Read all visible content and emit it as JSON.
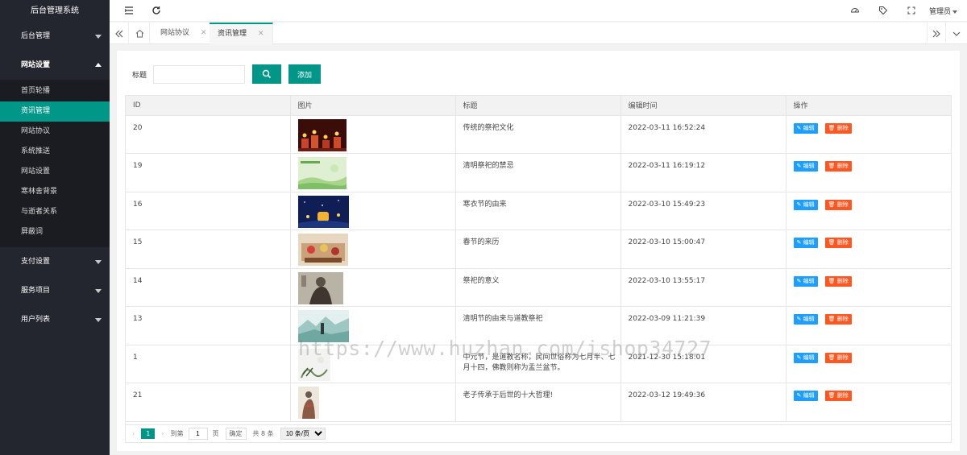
{
  "app": {
    "title": "后台管理系统",
    "admin_label": "管理员"
  },
  "colors": {
    "accent": "#009688",
    "sidebar_bg": "#23262e",
    "edit": "#1e9fff",
    "delete": "#ff5722"
  },
  "sidebar": {
    "groups": [
      {
        "label": "后台管理"
      },
      {
        "label": "网站设置",
        "open": true,
        "items": [
          {
            "label": "首页轮播"
          },
          {
            "label": "资讯管理",
            "active": true
          },
          {
            "label": "网站协议"
          },
          {
            "label": "系统推送"
          },
          {
            "label": "网站设置"
          },
          {
            "label": "寒林舍背景"
          },
          {
            "label": "与逝者关系"
          },
          {
            "label": "屏蔽词"
          }
        ]
      },
      {
        "label": "支付设置"
      },
      {
        "label": "服务项目"
      },
      {
        "label": "用户列表"
      }
    ]
  },
  "tabs": [
    {
      "label": "网站协议"
    },
    {
      "label": "资讯管理",
      "active": true
    }
  ],
  "search": {
    "label": "标题",
    "value": "",
    "add_label": "添加"
  },
  "table": {
    "headers": [
      "ID",
      "图片",
      "标题",
      "编辑时间",
      "操作"
    ],
    "edit_label": "编辑",
    "delete_label": "删除",
    "rows": [
      {
        "id": "20",
        "title": "传统的祭祀文化",
        "time": "2022-03-11 16:52:24",
        "img": "candles"
      },
      {
        "id": "19",
        "title": "清明祭祀的禁忌",
        "time": "2022-03-11 16:19:12",
        "img": "green"
      },
      {
        "id": "16",
        "title": "寒衣节的由来",
        "time": "2022-03-10 15:49:23",
        "img": "lantern"
      },
      {
        "id": "15",
        "title": "春节的来历",
        "time": "2022-03-10 15:00:47",
        "img": "festival"
      },
      {
        "id": "14",
        "title": "祭祀的意义",
        "time": "2022-03-10 13:55:17",
        "img": "sage"
      },
      {
        "id": "13",
        "title": "清明节的由来与道教祭祀",
        "time": "2022-03-09 11:21:39",
        "img": "landscape"
      },
      {
        "id": "1",
        "title": "中元节，是道教名称，民间世俗称为七月半、七月十四，佛教则称为盂兰盆节。",
        "time": "2021-12-30 15:18:01",
        "img": "ink"
      },
      {
        "id": "21",
        "title": "老子传承于后世的十大哲理!",
        "time": "2022-03-12 19:49:36",
        "img": "laozi"
      }
    ]
  },
  "pager": {
    "current": "1",
    "goto_label": "到第",
    "page_value": "1",
    "page_unit": "页",
    "confirm_label": "确定",
    "total": "共 8 条",
    "per_page": "10 条/页"
  },
  "watermark": "https://www.huzhan.com/ishop34727"
}
